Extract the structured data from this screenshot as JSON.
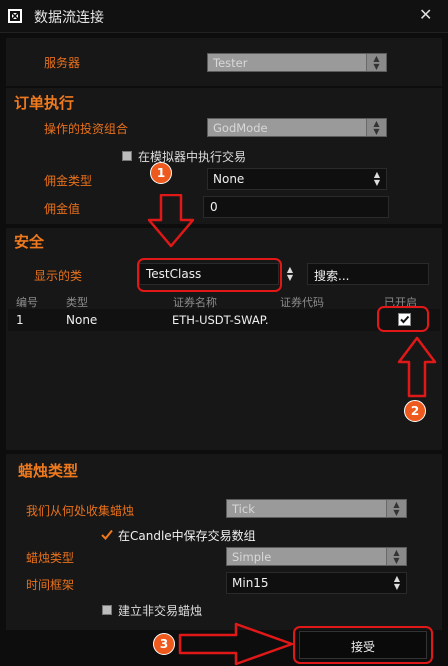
{
  "window": {
    "title": "数据流连接",
    "close_glyph": "✕"
  },
  "server": {
    "label": "服务器",
    "value": "Tester"
  },
  "order_execution": {
    "title": "订单执行",
    "portfolio_label": "操作的投资组合",
    "portfolio_value": "GodMode",
    "simulator_checkbox_label": "在模拟器中执行交易",
    "commission_type_label": "佣金类型",
    "commission_type_value": "None",
    "commission_value_label": "佣金值",
    "commission_value": "0"
  },
  "security": {
    "title": "安全",
    "display_class_label": "显示的类",
    "display_class_value": "TestClass",
    "search_button": "搜索...",
    "columns": [
      "编号",
      "类型",
      "证券名称",
      "证券代码",
      "已开启"
    ],
    "rows": [
      {
        "id": "1",
        "type": "None",
        "name": "ETH-USDT-SWAP.",
        "code": "",
        "enabled": true
      }
    ]
  },
  "candles": {
    "title": "蜡烛类型",
    "source_label": "我们从何处收集蜡烛",
    "source_value": "Tick",
    "save_trades_label": "在Candle中保存交易数组",
    "candle_type_label": "蜡烛类型",
    "candle_type_value": "Simple",
    "timeframe_label": "时间框架",
    "timeframe_value": "Min15",
    "non_trading_label": "建立非交易蜡烛"
  },
  "accept_button": "接受",
  "annotations": {
    "badge1": "1",
    "badge2": "2",
    "badge3": "3"
  },
  "colors": {
    "accent": "#ef7a1e",
    "highlight_red": "#e01818",
    "background": "#0d0d0d"
  }
}
